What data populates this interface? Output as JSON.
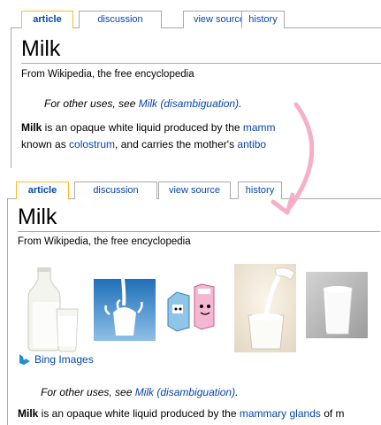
{
  "before": {
    "tabs": {
      "article": "article",
      "discussion": "discussion",
      "view_source": "view source",
      "history": "history"
    },
    "title": "Milk",
    "subtitle": "From Wikipedia, the free encyclopedia",
    "hatnote": {
      "prefix": "For other uses, see ",
      "link": "Milk (disambiguation)",
      "suffix": "."
    },
    "para": {
      "line1_bold": "Milk",
      "line1_text": " is an opaque white liquid produced by the ",
      "line1_link": "mamm",
      "line2_text1": "known as ",
      "line2_link1": "colostrum",
      "line2_text2": ", and carries the mother's ",
      "line2_link2": "antibo"
    }
  },
  "after": {
    "tabs": {
      "article": "article",
      "discussion": "discussion",
      "view_source": "view source",
      "history": "history"
    },
    "title": "Milk",
    "subtitle": "From Wikipedia, the free encyclopedia",
    "bing_label": "Bing Images",
    "hatnote": {
      "prefix": "For other uses, see ",
      "link": "Milk (disambiguation)",
      "suffix": "."
    },
    "para": {
      "bold": "Milk",
      "text1": " is an opaque white liquid produced by the ",
      "link": "mammary glands",
      "text2": " of m"
    }
  },
  "colors": {
    "link": "#0645ad",
    "tab_selected_border": "#fabd23",
    "border": "#aaaaaa",
    "arrow": "#f5b0c8",
    "bing_blue": "#1f8fd6"
  }
}
